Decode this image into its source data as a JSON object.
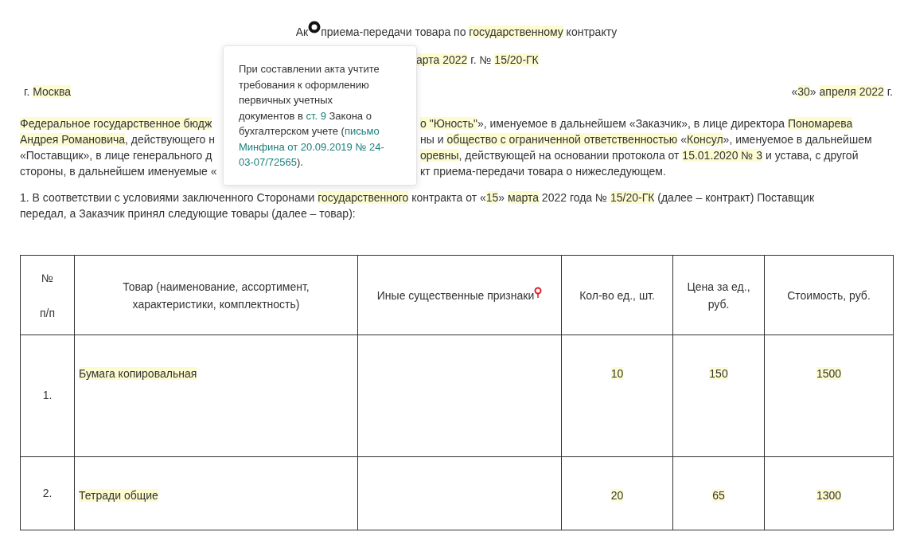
{
  "title": {
    "before_marker": "Ак",
    "after_marker": [
      {
        "text": "приема-передачи товара по ",
        "highlighted": false
      },
      {
        "text": "государственному",
        "highlighted": true
      },
      {
        "text": " контракту",
        "highlighted": false
      }
    ]
  },
  "subtitle_visible": [
    {
      "text": "арта ",
      "highlighted": true
    },
    {
      "text": "2022",
      "highlighted": true
    },
    {
      "text": " г. № ",
      "highlighted": false
    },
    {
      "text": "15/20-ГК",
      "highlighted": true
    }
  ],
  "place": [
    {
      "text": "г. ",
      "highlighted": false
    },
    {
      "text": "Москва",
      "highlighted": true
    }
  ],
  "date": [
    {
      "text": "«",
      "highlighted": false
    },
    {
      "text": "30",
      "highlighted": true
    },
    {
      "text": "» ",
      "highlighted": false
    },
    {
      "text": "апреля ",
      "highlighted": true
    },
    {
      "text": "2022",
      "highlighted": true
    },
    {
      "text": " г.",
      "highlighted": false
    }
  ],
  "parties_lines": [
    {
      "left": [
        {
          "text": "Федеральное государственное бюдж",
          "highlighted": true
        }
      ],
      "right": [
        {
          "text": "о \"Юность\"",
          "highlighted": true
        },
        {
          "text": "», именуемое в дальнейшем «Заказчик», в лице директора ",
          "highlighted": false
        },
        {
          "text": "Пономарева",
          "highlighted": true
        }
      ]
    },
    {
      "left": [
        {
          "text": "Андрея Романовича",
          "highlighted": true
        },
        {
          "text": ", действующего н",
          "highlighted": false
        }
      ],
      "right": [
        {
          "text": "ны и ",
          "highlighted": false
        },
        {
          "text": "общество с ограниченной ответственностью",
          "highlighted": true
        },
        {
          "text": " «",
          "highlighted": false
        },
        {
          "text": "Консул",
          "highlighted": true
        },
        {
          "text": "», именуемое в дальнейшем",
          "highlighted": false
        }
      ]
    },
    {
      "left": [
        {
          "text": "«Поставщик», в лице генерального д",
          "highlighted": false
        }
      ],
      "right": [
        {
          "text": "оревны",
          "highlighted": true
        },
        {
          "text": ", действующей на основании протокола от ",
          "highlighted": false
        },
        {
          "text": "15.01.2020 ",
          "highlighted": true
        },
        {
          "text": "№ ",
          "highlighted": true
        },
        {
          "text": "3",
          "highlighted": true
        },
        {
          "text": " и устава, с другой",
          "highlighted": false
        }
      ]
    },
    {
      "left": [
        {
          "text": "стороны, в дальнейшем именуемые «",
          "highlighted": false
        }
      ],
      "right": [
        {
          "text": "кт приема-передачи товара о нижеследующем.",
          "highlighted": false
        }
      ]
    }
  ],
  "clause_1": [
    {
      "text": "1. В соответствии с условиями заключенного Сторонами ",
      "highlighted": false
    },
    {
      "text": "государственного",
      "highlighted": true
    },
    {
      "text": " контракта от «",
      "highlighted": false
    },
    {
      "text": "15",
      "highlighted": true
    },
    {
      "text": "» ",
      "highlighted": false
    },
    {
      "text": "марта",
      "highlighted": true
    },
    {
      "text": " 2022 года № ",
      "highlighted": false
    },
    {
      "text": "15/20-ГК",
      "highlighted": true
    },
    {
      "text": " (далее – контракт) Поставщик передал, а Заказчик принял следующие товары (далее – товар):",
      "highlighted": false
    }
  ],
  "table": {
    "columns": [
      {
        "lines": [
          "№",
          "п/п"
        ]
      },
      {
        "lines": [
          "Товар (наименование, ассортимент,",
          "характеристики, комплектность)"
        ]
      },
      {
        "lines": [
          "Иные существенные признаки"
        ],
        "marker": true
      },
      {
        "lines": [
          "Кол-во ед., шт."
        ]
      },
      {
        "lines": [
          "Цена за ед.,",
          "руб."
        ]
      },
      {
        "lines": [
          "Стоимость, руб."
        ]
      }
    ],
    "rows": [
      {
        "number": "1.",
        "item": "Бумага копировальная",
        "quantity": "10",
        "price": "150",
        "cost": "1500",
        "highlighted": true
      },
      {
        "number": "2.",
        "item": "Тетради общие",
        "quantity": "20",
        "price": "65",
        "cost": "1300",
        "highlighted": true
      }
    ]
  },
  "tooltip": {
    "lines": [
      [
        {
          "kind": "text",
          "text": "При составлении акта учтите"
        }
      ],
      [
        {
          "kind": "text",
          "text": "требования к оформлению"
        }
      ],
      [
        {
          "kind": "text",
          "text": "первичных учетных"
        }
      ],
      [
        {
          "kind": "text",
          "text": "документов в "
        },
        {
          "kind": "link",
          "text": "ст. 9"
        },
        {
          "kind": "text",
          "text": " Закона о"
        }
      ],
      [
        {
          "kind": "text",
          "text": "бухгалтерском учете ("
        },
        {
          "kind": "link",
          "text": "письмо"
        }
      ],
      [
        {
          "kind": "link",
          "text": "Минфина от 20.09.2019 № 24-"
        }
      ],
      [
        {
          "kind": "link",
          "text": "03-07/72565"
        },
        {
          "kind": "text",
          "text": ")."
        }
      ]
    ]
  }
}
